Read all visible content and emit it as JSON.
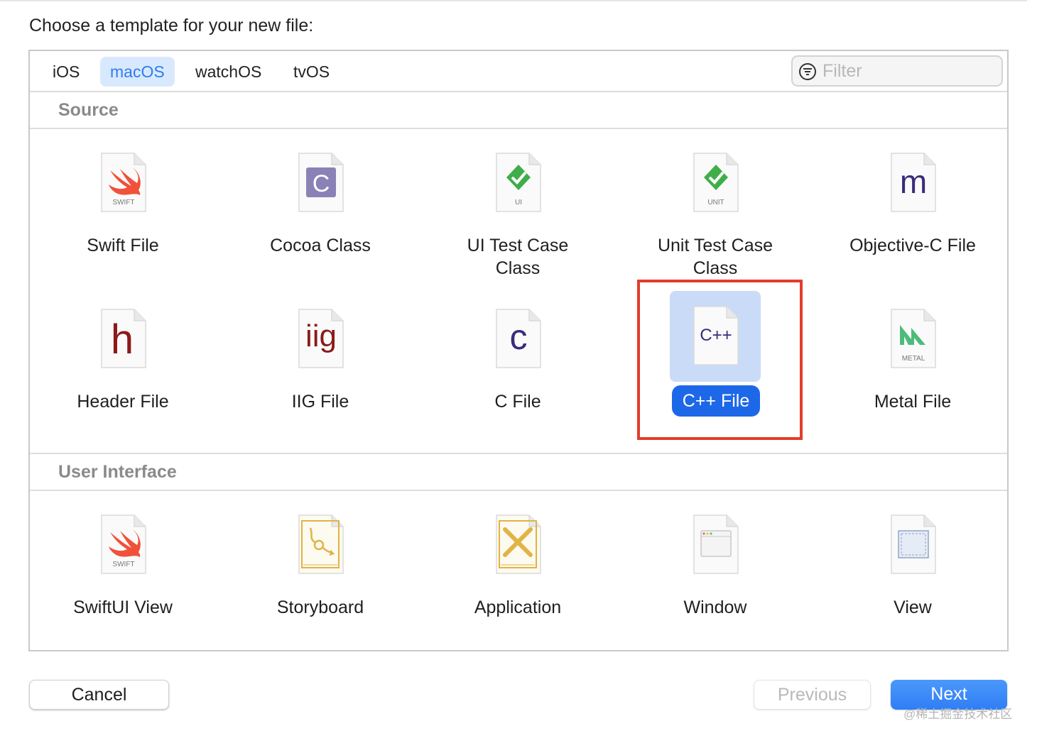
{
  "prompt": "Choose a template for your new file:",
  "tabs": [
    {
      "label": "iOS",
      "active": false
    },
    {
      "label": "macOS",
      "active": true
    },
    {
      "label": "watchOS",
      "active": false
    },
    {
      "label": "tvOS",
      "active": false
    }
  ],
  "filter": {
    "placeholder": "Filter",
    "icon": "filter-icon"
  },
  "sections": [
    {
      "title": "Source",
      "items": [
        {
          "label": "Swift File",
          "icon": "swift-file-icon",
          "badge": "SWIFT"
        },
        {
          "label": "Cocoa Class",
          "icon": "cocoa-class-icon",
          "badge": "C"
        },
        {
          "label": "UI Test Case Class",
          "icon": "ui-test-icon",
          "badge": "UI"
        },
        {
          "label": "Unit Test Case Class",
          "icon": "unit-test-icon",
          "badge": "UNIT"
        },
        {
          "label": "Objective-C File",
          "icon": "objc-file-icon",
          "badge": "m"
        },
        {
          "label": "Header File",
          "icon": "header-file-icon",
          "badge": "h"
        },
        {
          "label": "IIG File",
          "icon": "iig-file-icon",
          "badge": "iig"
        },
        {
          "label": "C File",
          "icon": "c-file-icon",
          "badge": "c"
        },
        {
          "label": "C++ File",
          "icon": "cpp-file-icon",
          "badge": "C++",
          "selected": true
        },
        {
          "label": "Metal File",
          "icon": "metal-file-icon",
          "badge": "METAL"
        }
      ]
    },
    {
      "title": "User Interface",
      "items": [
        {
          "label": "SwiftUI View",
          "icon": "swiftui-view-icon",
          "badge": "SWIFT"
        },
        {
          "label": "Storyboard",
          "icon": "storyboard-icon"
        },
        {
          "label": "Application",
          "icon": "application-icon"
        },
        {
          "label": "Window",
          "icon": "window-icon"
        },
        {
          "label": "View",
          "icon": "view-icon"
        }
      ]
    }
  ],
  "buttons": {
    "cancel": "Cancel",
    "previous": "Previous",
    "next": "Next"
  },
  "watermark": "@稀土掘金技术社区",
  "colors": {
    "accent": "#1d68e8",
    "selection_bg": "#c9dbf7",
    "annotation": "#e23d2b",
    "swift": "#f05138",
    "check": "#3fae49"
  }
}
